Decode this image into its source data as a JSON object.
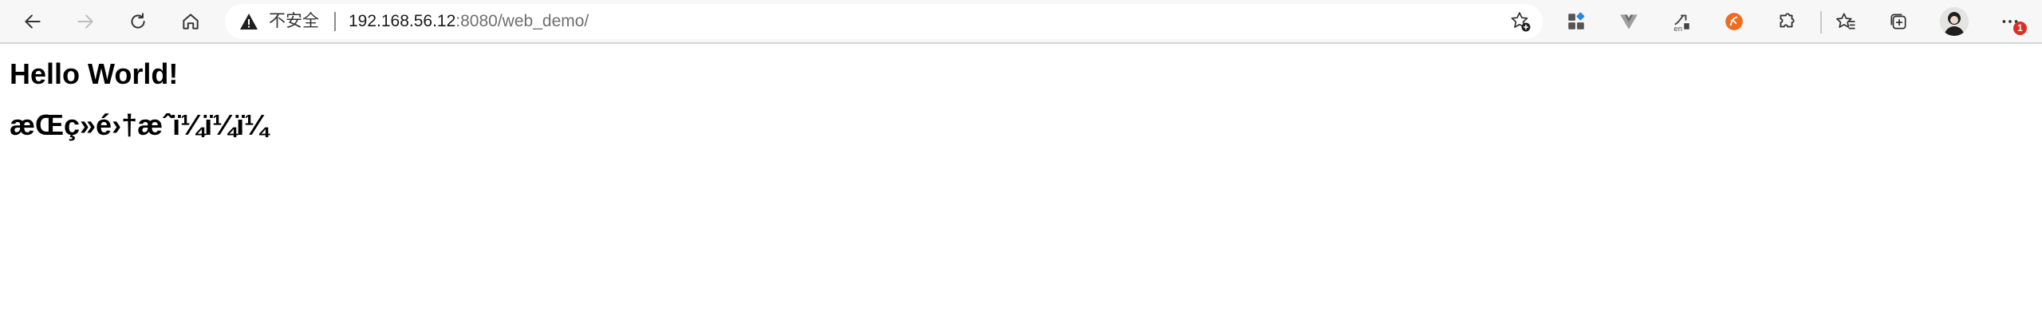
{
  "browser": {
    "security_label": "不安全",
    "url_host": "192.168.56.12",
    "url_rest": ":8080/web_demo/",
    "notification_count": "1",
    "icons": {
      "back": "back-arrow-icon",
      "forward": "forward-arrow-icon",
      "refresh": "refresh-icon",
      "home": "home-icon",
      "warning": "warning-icon",
      "add_favorite": "star-plus-icon",
      "extensions": [
        "apps-grid-icon",
        "vue-devtools-icon",
        "translate-icon",
        "orange-extension-icon",
        "puzzle-icon",
        "favorites-icon",
        "collections-icon"
      ],
      "profile": "avatar",
      "menu": "more-icon"
    },
    "colors": {
      "toolbar_bg": "#f7f7f7",
      "address_bg": "#ffffff",
      "badge": "#d93025",
      "orange_ext": "#f26b1d",
      "apps_blue": "#2b88d8"
    }
  },
  "page": {
    "heading": "Hello World!",
    "garbled_text": "æŒç»é›†æˆï¼ï¼ï¼"
  }
}
